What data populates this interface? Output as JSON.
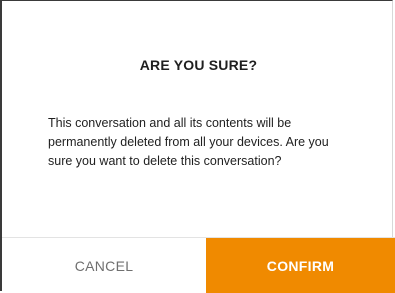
{
  "dialog": {
    "title": "ARE YOU SURE?",
    "message": "This conversation and all its contents will be permanently deleted from all your devices. Are you sure you want to delete this conversation?",
    "cancel_label": "CANCEL",
    "confirm_label": "CONFIRM"
  },
  "colors": {
    "accent": "#f08a00",
    "text": "#1f1f1f",
    "muted": "#6f6f6f"
  }
}
